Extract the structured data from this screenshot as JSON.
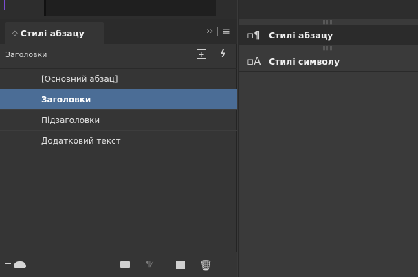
{
  "panel": {
    "tab_label": "Стилі абзацу",
    "group_name": "Заголовки",
    "items": [
      {
        "label": "[Основний абзац]",
        "selected": false
      },
      {
        "label": "Заголовки",
        "selected": true
      },
      {
        "label": "Підзаголовки",
        "selected": false
      },
      {
        "label": "Додатковий текст",
        "selected": false
      }
    ],
    "icons": {
      "overflow": "››",
      "menu": "≡",
      "new_group": "[+]",
      "quick_apply": "ϟ",
      "trash": "🗑"
    }
  },
  "right_panel": {
    "items": [
      {
        "label": "Стилі абзацу",
        "icon": "paragraph-styles-icon"
      },
      {
        "label": "Стилі символу",
        "icon": "character-styles-icon"
      }
    ]
  },
  "colors": {
    "selection": "#4b6d96",
    "panel_bg": "#353535"
  }
}
